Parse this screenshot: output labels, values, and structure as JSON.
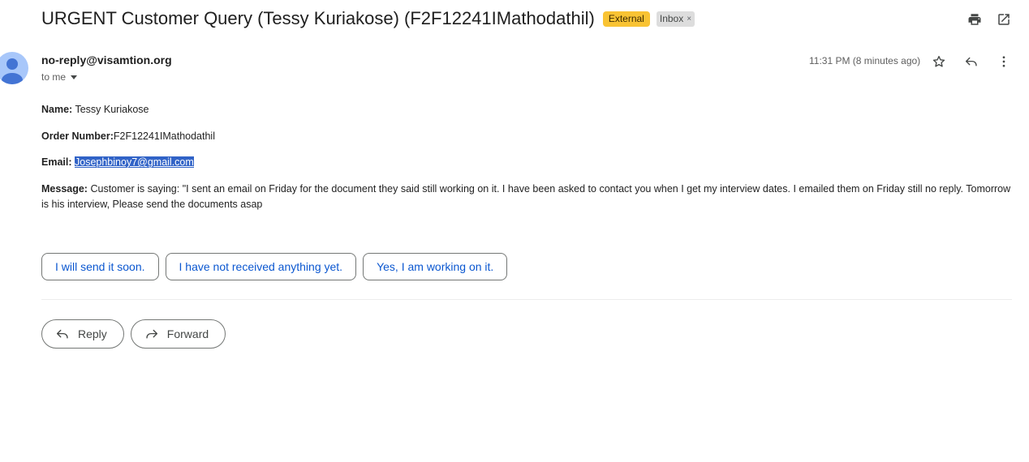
{
  "header": {
    "subject": "URGENT Customer Query (Tessy Kuriakose) (F2F12241IMathodathil)",
    "label_external": "External",
    "label_inbox": "Inbox",
    "label_inbox_remove": "×"
  },
  "toolbar": {
    "print_icon": "print-icon",
    "popout_icon": "open-in-new-window-icon"
  },
  "message": {
    "sender": "no-reply@visamtion.org",
    "recipient": "to me",
    "time": "11:31 PM (8 minutes ago)",
    "name_label": "Name:",
    "name_value": "Tessy Kuriakose",
    "order_label": "Order Number:",
    "order_value": "F2F12241IMathodathil",
    "email_label": "Email:",
    "email_value": "Josephbinoy7@gmail.com",
    "message_label": "Message:",
    "message_text": "Customer is saying: \"I sent an email on Friday for the document they said still working on it. I have been asked to contact you when I get my interview dates. I emailed them on Friday still no reply. Tomorrow is his interview, Please send the documents asap"
  },
  "smart_replies": [
    "I will send it soon.",
    "I have not received anything yet.",
    "Yes, I am working on it."
  ],
  "actions": {
    "reply_label": "Reply",
    "forward_label": "Forward"
  },
  "colors": {
    "accent": "#0b57d0",
    "external_label": "#f9c333",
    "selection": "#3163c7",
    "avatar": "#a8c7fa"
  }
}
